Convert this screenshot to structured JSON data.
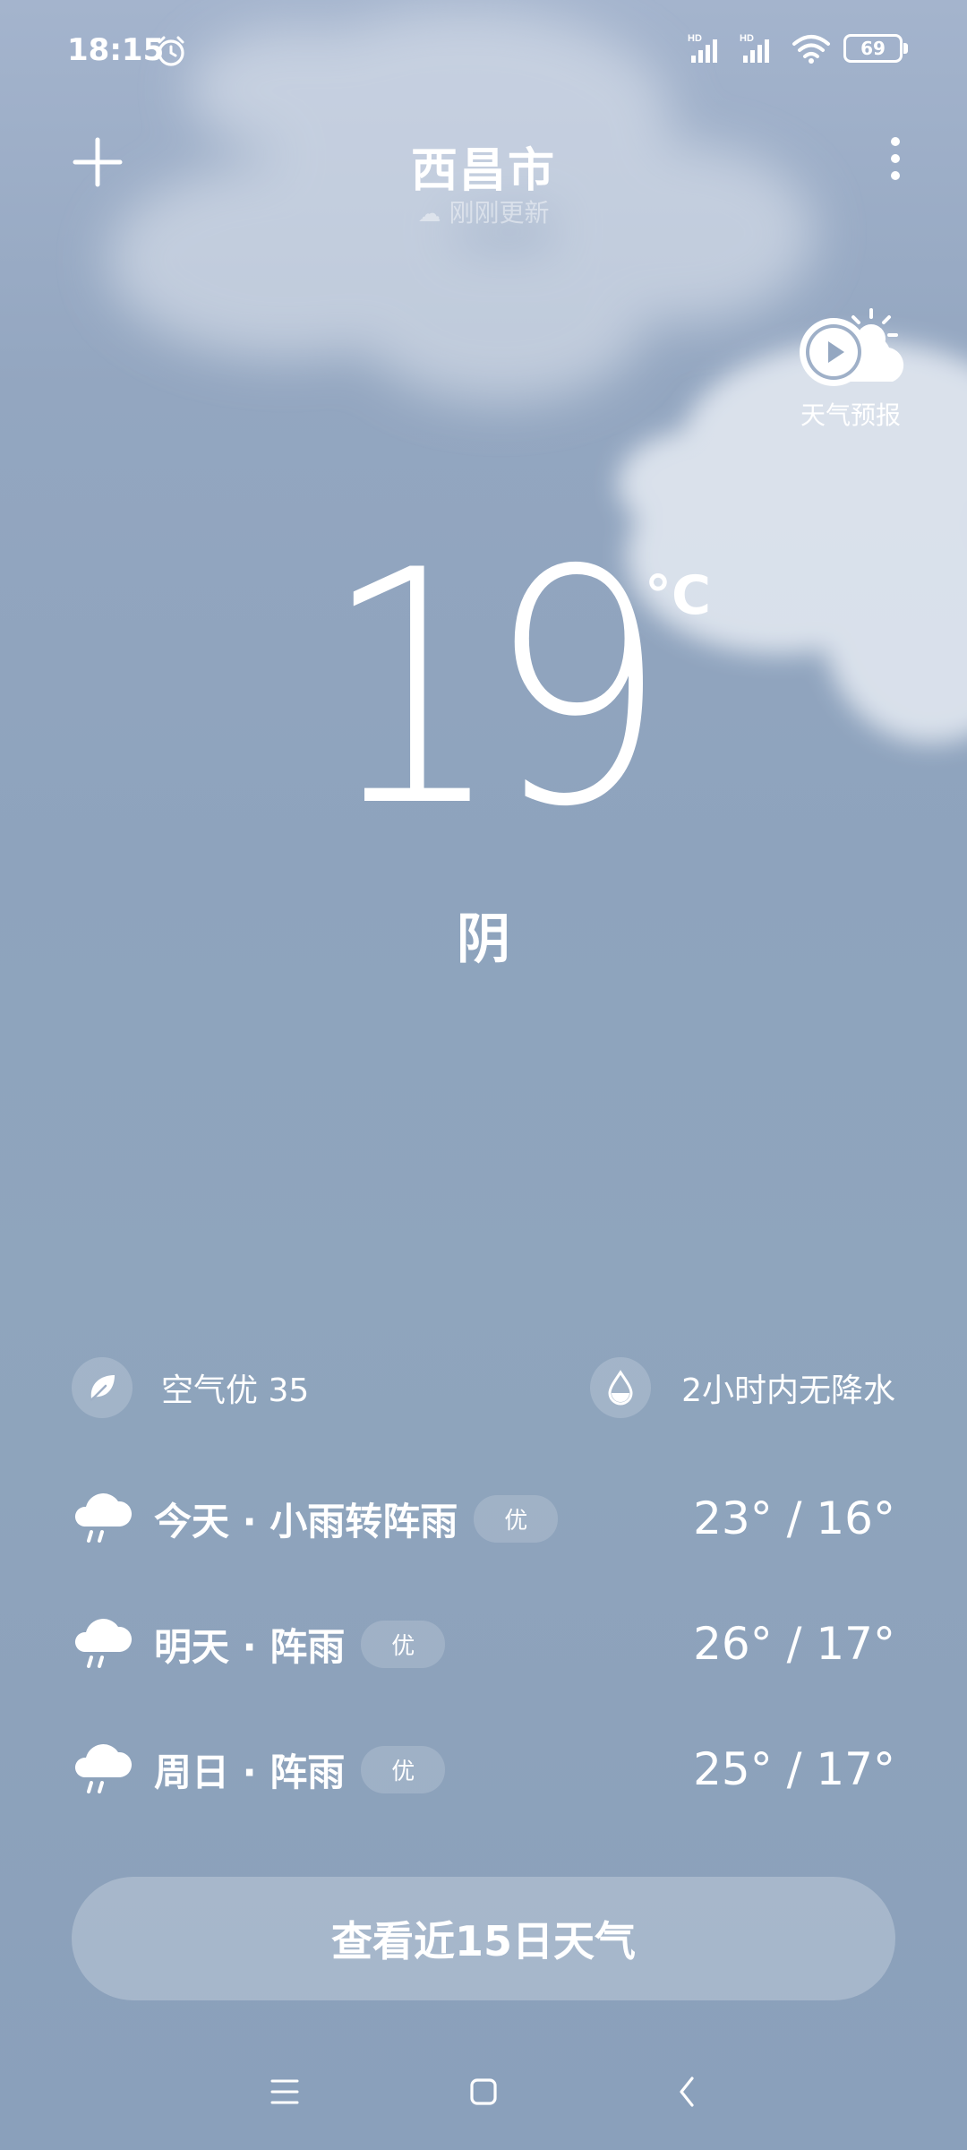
{
  "status_bar": {
    "time": "18:15",
    "battery": "69",
    "icons": [
      "alarm-icon",
      "signal-hd-icon",
      "signal-hd-icon",
      "wifi-icon",
      "battery-icon"
    ]
  },
  "header": {
    "city": "西昌市",
    "updated": "刚刚更新",
    "add_icon": "plus-icon",
    "more_icon": "more-vertical-icon"
  },
  "video": {
    "label": "天气预报",
    "icon": "weather-video-icon"
  },
  "current": {
    "temperature": "19",
    "unit": "°C",
    "condition": "阴"
  },
  "air": {
    "label": "空气优 35",
    "icon": "leaf-icon"
  },
  "precipitation": {
    "label": "2小时内无降水",
    "icon": "water-drop-icon"
  },
  "forecast": [
    {
      "label": "今天 · 小雨转阵雨",
      "aqi": "优",
      "range": "23° / 16°",
      "icon": "rain-cloud-icon"
    },
    {
      "label": "明天 · 阵雨",
      "aqi": "优",
      "range": "26° / 17°",
      "icon": "rain-cloud-icon"
    },
    {
      "label": "周日 · 阵雨",
      "aqi": "优",
      "range": "25° / 17°",
      "icon": "rain-cloud-icon"
    }
  ],
  "button_15day": "查看近15日天气",
  "colors": {
    "background_top": "#a4b4cd",
    "background_bottom": "#8aa0bb",
    "text": "#ffffff"
  }
}
